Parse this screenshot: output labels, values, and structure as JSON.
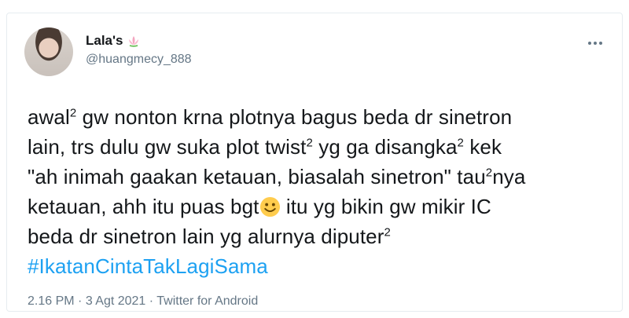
{
  "user": {
    "display_name": "Lala's",
    "handle": "@huangmecy_888",
    "name_emoji": "lotus-icon"
  },
  "tweet": {
    "lines": [
      {
        "parts": [
          "awal",
          "2",
          " gw nonton krna plotnya bagus beda dr sinetron"
        ]
      },
      {
        "parts": [
          "lain, trs dulu gw suka plot twist",
          "2",
          " yg ga disangka",
          "2",
          " kek"
        ]
      },
      {
        "parts": [
          "\"ah inimah gaakan ketauan, biasalah sinetron\" tau",
          "2",
          "nya"
        ]
      },
      {
        "parts": [
          "ketauan, ahh itu puas bgt",
          " itu yg bikin gw mikir IC"
        ]
      },
      {
        "parts": [
          "beda dr sinetron lain yg alurnya diputer",
          "2"
        ]
      }
    ],
    "hashtag": "#IkatanCintaTakLagiSama",
    "emoji": "smiling-face-icon"
  },
  "meta": {
    "time": "2.16 PM",
    "separator": " · ",
    "date": "3 Agt 2021",
    "source": "Twitter for Android"
  },
  "colors": {
    "link": "#1da1f2",
    "text": "#14171a",
    "muted": "#657786",
    "border": "#e6ecf0"
  }
}
